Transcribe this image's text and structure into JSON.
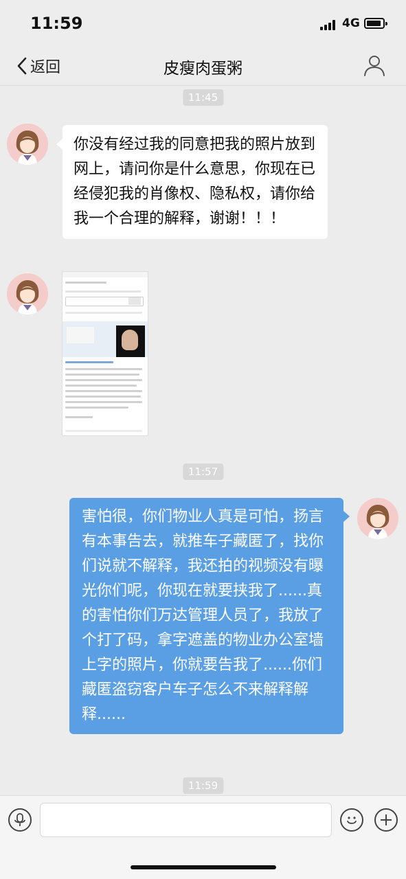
{
  "status": {
    "time": "11:59",
    "network": "4G"
  },
  "nav": {
    "back_label": "返回",
    "title": "皮瘦肉蛋粥"
  },
  "timestamps": [
    "11:45",
    "11:57",
    "11:59"
  ],
  "messages": [
    {
      "side": "left",
      "type": "text",
      "text": "你没有经过我的同意把我的照片放到网上，请问你是什么意思，你现在已经侵犯我的肖像权、隐私权，请你给我一个合理的解释，谢谢！！！"
    },
    {
      "side": "left",
      "type": "image"
    },
    {
      "side": "right",
      "type": "text",
      "text": "害怕很，你们物业人真是可怕，扬言有本事告去，就推车子藏匿了，找你们说就不解释，我还拍的视频没有曝光你们呢，你现在就要挟我了......真的害怕你们万达管理人员了，我放了个打了码，拿字遮盖的物业办公室墙上字的照片，你就要告我了......你们藏匿盗窃客户车子怎么不来解释解释......"
    }
  ],
  "input": {
    "value": ""
  },
  "icons": {
    "back": "chevron-left-icon",
    "profile": "person-icon",
    "voice": "voice-icon",
    "emoji": "smiley-icon",
    "more": "plus-icon"
  },
  "colors": {
    "right_bubble": "#5a9fe3",
    "left_bubble": "#ffffff",
    "background": "#ececec"
  }
}
